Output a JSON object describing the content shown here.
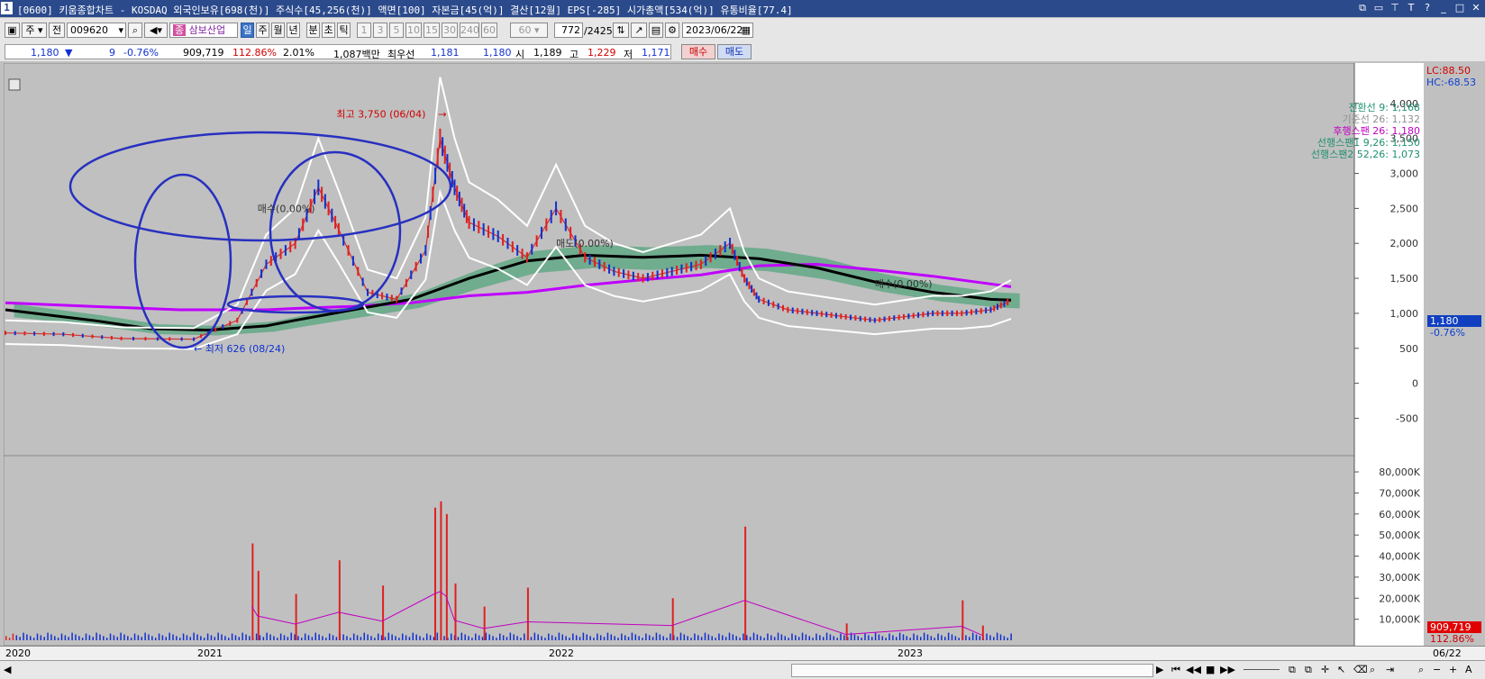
{
  "window": {
    "number": "1",
    "title": "[0600] 키움종합차트 - KOSDAQ 외국인보유[698(천)] 주식수[45,256(천)] 액면[100] 자본금[45(억)] 결산[12월] EPS[-285] 시가총액[534(억)] 유통비율[77.4]"
  },
  "toolbar": {
    "mode": "주",
    "prev": "전",
    "code": "009620",
    "stock_name": "삼보산업",
    "periods": [
      "일",
      "주",
      "월",
      "년",
      "분",
      "초",
      "틱"
    ],
    "active_period": "일",
    "intervals": [
      "1",
      "3",
      "5",
      "10",
      "15",
      "30",
      "240",
      "60"
    ],
    "interval_select": "60",
    "count": "772",
    "total": "/2425",
    "date": "2023/06/22"
  },
  "quote": {
    "price": "1,180",
    "change_arrow": "▼",
    "change": "9",
    "change_pct": "-0.76%",
    "volume": "909,719",
    "vol_ratio": "112.86%",
    "turnover": "2.01%",
    "amount": "1,087백만",
    "best_label": "최우선",
    "ask": "1,181",
    "bid": "1,180",
    "open_label": "시",
    "open": "1,189",
    "high_label": "고",
    "high": "1,229",
    "low_label": "저",
    "low": "1,171",
    "buy_label": "매수",
    "sell_label": "매도"
  },
  "chart_data": [
    {
      "type": "line",
      "title": "",
      "y_ticks": [
        "4,000",
        "3,500",
        "3,000",
        "2,500",
        "2,000",
        "1,500",
        "1,000",
        "500",
        "0",
        "-500"
      ],
      "ylim": [
        -700,
        4500
      ],
      "x_labels": [
        "2020",
        "2021",
        "2022",
        "2023",
        "06/22"
      ],
      "legend": [
        {
          "label": "전환선 9: 1,168",
          "color": "#209070"
        },
        {
          "label": "기준선 26: 1,132",
          "color": "#909090"
        },
        {
          "label": "후행스팬 26: 1,180",
          "color": "#c000c0"
        },
        {
          "label": "선행스팬1 9,26: 1,150",
          "color": "#209070"
        },
        {
          "label": "선행스팬2 52,26: 1,073",
          "color": "#209070"
        }
      ],
      "legend_position": "top-right",
      "indicators": {
        "lc": "LC:88.50",
        "hc": "HC:-68.53"
      },
      "annotations": {
        "high": "최고 3,750 (06/04)",
        "low": "최저 626 (08/24)",
        "signal_1": "매수(0.00%)",
        "signal_2": "매도(0.00%)",
        "signal_3": "매수(0.00%)"
      },
      "last_price": "1,180",
      "last_change": "-0.76%",
      "series": [
        {
          "name": "",
          "color": "#d03030",
          "points": [
            [
              2020.0,
              720
            ],
            [
              2020.2,
              700
            ],
            [
              2020.4,
              640
            ],
            [
              2020.65,
              630
            ],
            [
              2020.8,
              900
            ],
            [
              2020.9,
              1700
            ],
            [
              2021.0,
              2000
            ],
            [
              2021.08,
              2800
            ],
            [
              2021.15,
              2200
            ],
            [
              2021.25,
              1300
            ],
            [
              2021.35,
              1200
            ],
            [
              2021.45,
              1900
            ],
            [
              2021.5,
              3500
            ],
            [
              2021.55,
              2800
            ],
            [
              2021.6,
              2300
            ],
            [
              2021.7,
              2100
            ],
            [
              2021.8,
              1800
            ],
            [
              2021.9,
              2500
            ],
            [
              2022.0,
              1800
            ],
            [
              2022.1,
              1600
            ],
            [
              2022.2,
              1500
            ],
            [
              2022.3,
              1600
            ],
            [
              2022.4,
              1700
            ],
            [
              2022.5,
              2000
            ],
            [
              2022.55,
              1500
            ],
            [
              2022.6,
              1200
            ],
            [
              2022.7,
              1050
            ],
            [
              2022.8,
              1000
            ],
            [
              2022.9,
              950
            ],
            [
              2023.0,
              900
            ],
            [
              2023.1,
              950
            ],
            [
              2023.2,
              1000
            ],
            [
              2023.3,
              1000
            ],
            [
              2023.4,
              1050
            ],
            [
              2023.47,
              1180
            ]
          ]
        },
        {
          "name": "",
          "color": "#c000ff",
          "points": [
            [
              2020.0,
              1150
            ],
            [
              2020.3,
              1100
            ],
            [
              2020.6,
              1050
            ],
            [
              2020.9,
              1050
            ],
            [
              2021.0,
              1070
            ],
            [
              2021.2,
              1100
            ],
            [
              2021.4,
              1150
            ],
            [
              2021.6,
              1250
            ],
            [
              2021.8,
              1300
            ],
            [
              2022.0,
              1400
            ],
            [
              2022.2,
              1480
            ],
            [
              2022.4,
              1550
            ],
            [
              2022.6,
              1680
            ],
            [
              2022.8,
              1700
            ],
            [
              2023.0,
              1620
            ],
            [
              2023.2,
              1530
            ],
            [
              2023.4,
              1420
            ],
            [
              2023.47,
              1380
            ]
          ]
        },
        {
          "name": "",
          "color": "#000000",
          "points": [
            [
              2020.0,
              1050
            ],
            [
              2020.3,
              900
            ],
            [
              2020.5,
              780
            ],
            [
              2020.7,
              760
            ],
            [
              2020.9,
              820
            ],
            [
              2021.0,
              900
            ],
            [
              2021.2,
              1050
            ],
            [
              2021.4,
              1200
            ],
            [
              2021.6,
              1500
            ],
            [
              2021.8,
              1750
            ],
            [
              2022.0,
              1830
            ],
            [
              2022.2,
              1800
            ],
            [
              2022.4,
              1830
            ],
            [
              2022.6,
              1780
            ],
            [
              2022.8,
              1650
            ],
            [
              2023.0,
              1450
            ],
            [
              2023.2,
              1300
            ],
            [
              2023.4,
              1200
            ],
            [
              2023.47,
              1190
            ]
          ]
        }
      ]
    },
    {
      "type": "bar",
      "title": "",
      "y_ticks": [
        "80,000K",
        "70,000K",
        "60,000K",
        "50,000K",
        "40,000K",
        "30,000K",
        "20,000K",
        "10,000K"
      ],
      "ylim": [
        0,
        86000
      ],
      "x_labels": [
        "2020",
        "2021",
        "2022",
        "2023"
      ],
      "last_volume": "909,719",
      "last_ratio": "112.86%",
      "peaks": [
        [
          2020.85,
          46000
        ],
        [
          2020.87,
          33000
        ],
        [
          2021.0,
          22000
        ],
        [
          2021.15,
          38000
        ],
        [
          2021.3,
          26000
        ],
        [
          2021.48,
          63000
        ],
        [
          2021.5,
          66000
        ],
        [
          2021.52,
          60000
        ],
        [
          2021.55,
          27000
        ],
        [
          2021.65,
          16000
        ],
        [
          2021.8,
          25000
        ],
        [
          2022.3,
          20000
        ],
        [
          2022.55,
          54000
        ],
        [
          2022.9,
          8000
        ],
        [
          2023.3,
          19000
        ],
        [
          2023.37,
          7000
        ]
      ]
    }
  ],
  "scrollbar": {
    "left_arrow": "◀",
    "right_arrow": "▶",
    "controls": [
      "⏮",
      "◀◀",
      "■",
      "▶▶"
    ],
    "zoom": [
      "−",
      "+",
      "A"
    ]
  }
}
